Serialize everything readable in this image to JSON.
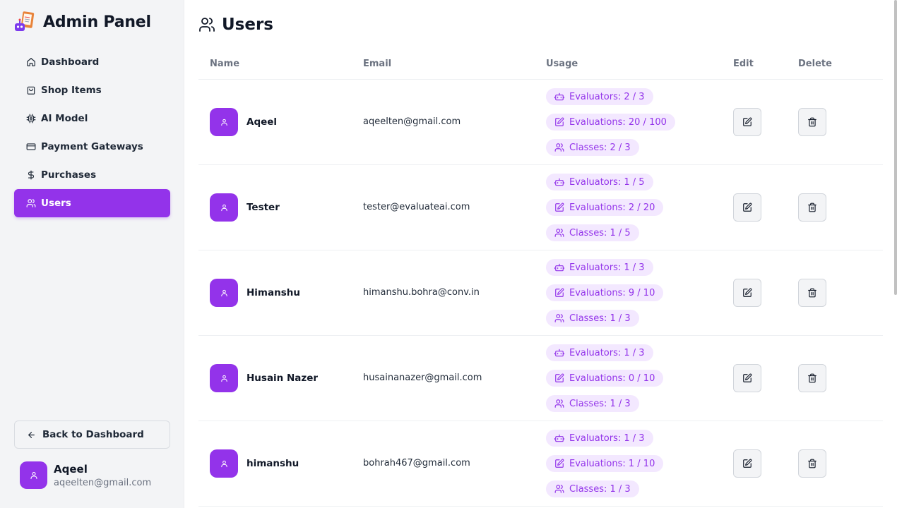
{
  "app": {
    "title": "Admin Panel"
  },
  "sidebar": {
    "items": [
      {
        "label": "Dashboard",
        "icon": "home-icon",
        "active": false
      },
      {
        "label": "Shop Items",
        "icon": "shopping-bag-icon",
        "active": false
      },
      {
        "label": "AI Model",
        "icon": "cpu-icon",
        "active": false
      },
      {
        "label": "Payment Gateways",
        "icon": "credit-card-icon",
        "active": false
      },
      {
        "label": "Purchases",
        "icon": "dollar-icon",
        "active": false
      },
      {
        "label": "Users",
        "icon": "users-icon",
        "active": true
      }
    ],
    "back_label": "Back to Dashboard",
    "profile": {
      "name": "Aqeel",
      "email": "aqeelten@gmail.com"
    }
  },
  "page": {
    "title": "Users"
  },
  "table": {
    "headers": {
      "name": "Name",
      "email": "Email",
      "usage": "Usage",
      "edit": "Edit",
      "delete": "Delete"
    },
    "rows": [
      {
        "name": "Aqeel",
        "email": "aqeelten@gmail.com",
        "evaluators": "Evaluators: 2 / 3",
        "evaluations": "Evaluations: 20 / 100",
        "classes": "Classes: 2 / 3"
      },
      {
        "name": "Tester",
        "email": "tester@evaluateai.com",
        "evaluators": "Evaluators: 1 / 5",
        "evaluations": "Evaluations: 2 / 20",
        "classes": "Classes: 1 / 5"
      },
      {
        "name": "Himanshu",
        "email": "himanshu.bohra@conv.in",
        "evaluators": "Evaluators: 1 / 3",
        "evaluations": "Evaluations: 9 / 10",
        "classes": "Classes: 1 / 3"
      },
      {
        "name": "Husain Nazer",
        "email": "husainanazer@gmail.com",
        "evaluators": "Evaluators: 1 / 3",
        "evaluations": "Evaluations: 0 / 10",
        "classes": "Classes: 1 / 3"
      },
      {
        "name": "himanshu",
        "email": "bohrah467@gmail.com",
        "evaluators": "Evaluators: 1 / 3",
        "evaluations": "Evaluations: 1 / 10",
        "classes": "Classes: 1 / 3"
      }
    ]
  },
  "colors": {
    "accent": "#9333ea",
    "pill_bg": "#f3e8ff",
    "sidebar_bg": "#f3f4f6"
  }
}
